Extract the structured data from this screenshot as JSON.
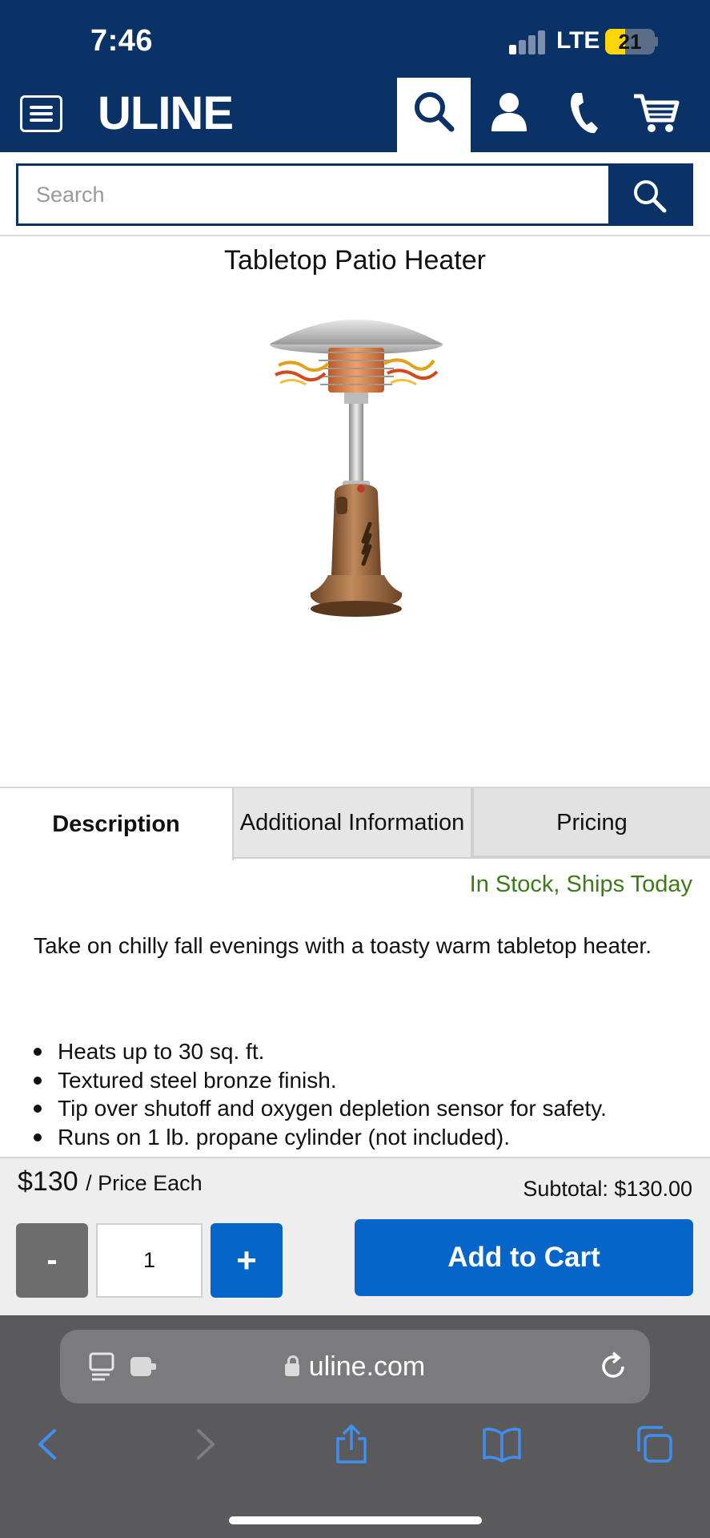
{
  "status_bar": {
    "time": "7:46",
    "network": "LTE",
    "battery": "21",
    "battery_level": 0.21
  },
  "header": {
    "logo": "ULINE",
    "icons": [
      "menu-icon",
      "search-icon",
      "account-icon",
      "phone-icon",
      "cart-icon"
    ]
  },
  "search": {
    "placeholder": "Search",
    "value": ""
  },
  "product": {
    "title": "Tabletop Patio Heater",
    "image_alt": "tabletop-patio-heater-image"
  },
  "tabs": [
    {
      "label": "Description",
      "active": true
    },
    {
      "label": "Additional Information",
      "active": false
    },
    {
      "label": "Pricing",
      "active": false
    }
  ],
  "stock_status": "In Stock, Ships Today",
  "description": {
    "intro": "Take on chilly fall evenings with a toasty warm tabletop heater.",
    "bullets": [
      "Heats up to 30 sq. ft.",
      "Textured steel bronze finish.",
      "Tip over shutoff and oxygen depletion sensor for safety.",
      "Runs on 1 lb. propane cylinder (not included)."
    ]
  },
  "purchase": {
    "price": "$130",
    "price_unit": "/ Price Each",
    "subtotal": "Subtotal: $130.00",
    "minus_label": "-",
    "quantity": "1",
    "plus_label": "+",
    "add_to_cart": "Add to Cart"
  },
  "browser": {
    "url": "uline.com"
  },
  "colors": {
    "header_bg": "#0b3266",
    "accent_blue": "#0565c9",
    "stock_green": "#3e7a18"
  }
}
